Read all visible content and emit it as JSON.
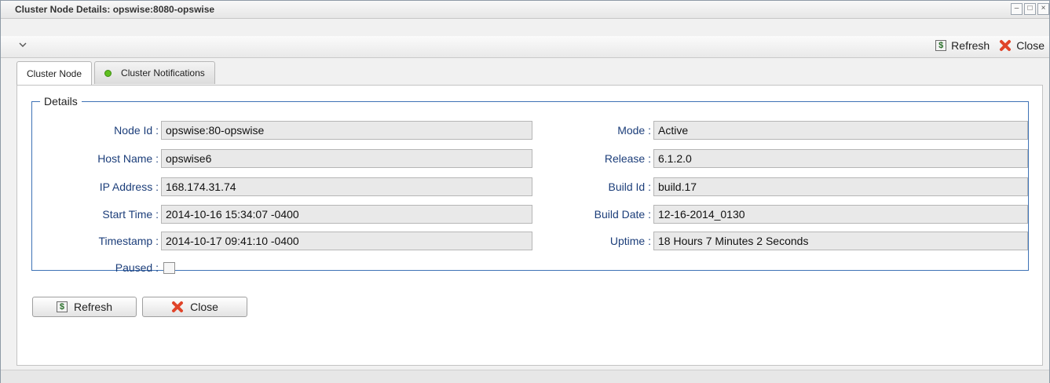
{
  "window": {
    "title": "Cluster Node Details: opswise:8080-opswise",
    "controls": [
      "minimize-icon",
      "maximize-icon",
      "close-icon"
    ]
  },
  "toolbar": {
    "collapse_icon": "chevron-down-icon",
    "refresh_label": "Refresh",
    "close_label": "Close"
  },
  "tabs": [
    {
      "label": "Cluster Node",
      "active": true
    },
    {
      "label": "Cluster Notifications",
      "active": false,
      "status_color": "#5fbf1f"
    }
  ],
  "details": {
    "legend": "Details",
    "left": [
      {
        "label": "Node Id :",
        "value": "opswise:80-opswise"
      },
      {
        "label": "Host Name :",
        "value": "opswise6"
      },
      {
        "label": "IP Address :",
        "value": "168.174.31.74"
      },
      {
        "label": "Start Time :",
        "value": "2014-10-16 15:34:07 -0400"
      },
      {
        "label": "Timestamp :",
        "value": "2014-10-17 09:41:10 -0400"
      }
    ],
    "paused": {
      "label": "Paused :",
      "checked": false
    },
    "right": [
      {
        "label": "Mode :",
        "value": "Active"
      },
      {
        "label": "Release :",
        "value": "6.1.2.0"
      },
      {
        "label": "Build Id :",
        "value": "build.17"
      },
      {
        "label": "Build Date :",
        "value": "12-16-2014_0130"
      },
      {
        "label": "Uptime :",
        "value": "18 Hours 7 Minutes 2 Seconds"
      }
    ]
  },
  "buttons": {
    "refresh_label": "Refresh",
    "close_label": "Close"
  },
  "colors": {
    "label_text": "#1c3e7a",
    "fieldset_border": "#3e72b5",
    "status_dot": "#5fbf1f",
    "close_icon": "#e0442a"
  }
}
